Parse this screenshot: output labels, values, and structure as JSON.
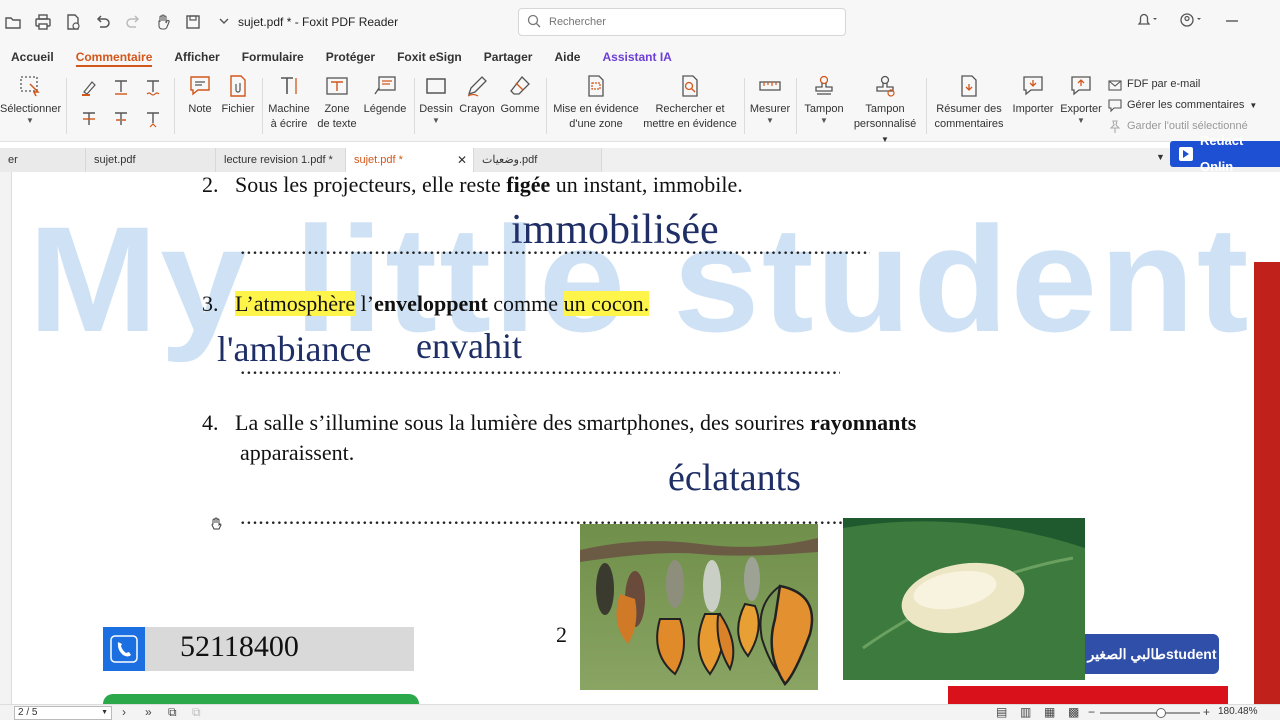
{
  "window": {
    "title": "sujet.pdf * - Foxit PDF Reader",
    "search_placeholder": "Rechercher"
  },
  "menu_tabs": [
    "Accueil",
    "Commentaire",
    "Afficher",
    "Formulaire",
    "Protéger",
    "Foxit eSign",
    "Partager",
    "Aide",
    "Assistant IA"
  ],
  "active_menu_tab": "Commentaire",
  "ribbon": {
    "select": "Sélectionner",
    "note": "Note",
    "file": "Fichier",
    "typewriter": [
      "Machine",
      "à écrire"
    ],
    "textbox": [
      "Zone",
      "de texte"
    ],
    "callout": "Légende",
    "drawing": "Dessin",
    "pencil": "Crayon",
    "eraser": "Gomme",
    "area_highlight": [
      "Mise en évidence",
      "d'une zone"
    ],
    "search_highlight": [
      "Rechercher et",
      "mettre en évidence"
    ],
    "measure": "Mesurer",
    "stamp": "Tampon",
    "custom_stamp": [
      "Tampon",
      "personnalisé"
    ],
    "summarize": [
      "Résumer des",
      "commentaires"
    ],
    "import": "Importer",
    "export": "Exporter",
    "fdf_email": "FDF par e-mail",
    "manage_comments": "Gérer les commentaires",
    "keep_tool": "Garder l'outil sélectionné"
  },
  "doc_tabs": [
    {
      "label": "er"
    },
    {
      "label": "sujet.pdf"
    },
    {
      "label": "lecture revision 1.pdf *"
    },
    {
      "label": "sujet.pdf *"
    },
    {
      "label": "وضعيات.pdf"
    }
  ],
  "redact_button": "Redact Onlin",
  "document": {
    "watermark": "My little student",
    "q2": {
      "num": "2.",
      "before": "Sous les projecteurs, elle reste ",
      "bold": "figée",
      "after": " un instant, immobile.",
      "answer": "immobilisée"
    },
    "q3": {
      "num": "3.",
      "h1": "L’atmosphère",
      "mid1": " l’",
      "bold": "enveloppent",
      "mid2": " comme ",
      "h2": "un cocon.",
      "answer1": "l'ambiance",
      "answer2": "envahit"
    },
    "q4": {
      "num": "4.",
      "line1_before": "La salle s’illumine sous la lumière des smartphones, des sourires ",
      "bold": "rayonnants",
      "line2": "apparaissent.",
      "answer": "éclatants"
    },
    "phone": "52118400",
    "page_number": "2",
    "badge": "طالبي الصغيرstudent"
  },
  "status": {
    "page": "2 / 5",
    "zoom": "180.48%"
  },
  "colors": {
    "accent": "#d2571a",
    "ai": "#6c3fd6",
    "redact": "#1e50d4",
    "highlight": "#fff44a",
    "watermark": "#cfe2f5",
    "handwriting": "#1f2f66"
  }
}
